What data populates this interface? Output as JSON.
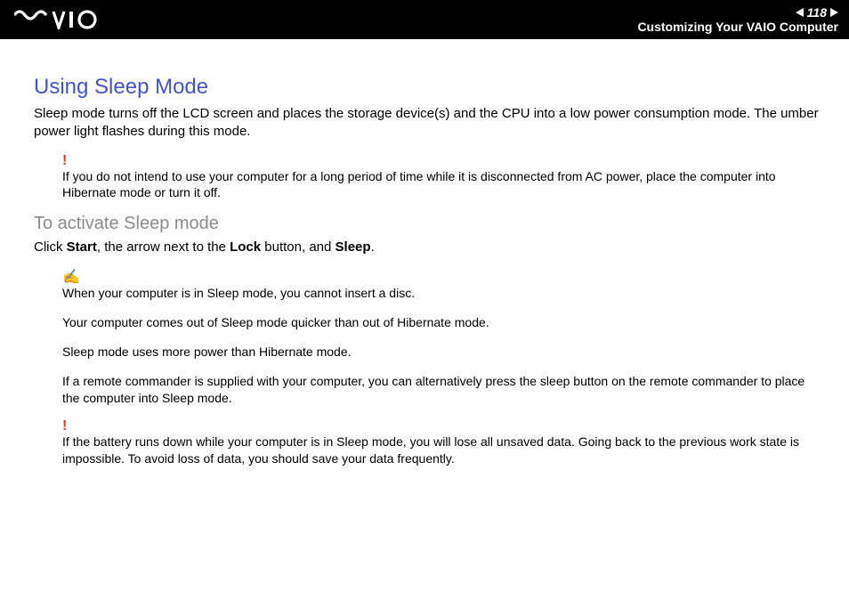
{
  "header": {
    "page_number": "118",
    "section": "Customizing Your VAIO Computer"
  },
  "main": {
    "title": "Using Sleep Mode",
    "intro": "Sleep mode turns off the LCD screen and places the storage device(s) and the CPU into a low power consumption mode. The umber power light flashes during this mode.",
    "warning1": "If you do not intend to use your computer for a long period of time while it is disconnected from AC power, place the computer into Hibernate mode or turn it off.",
    "subheading": "To activate Sleep mode",
    "instruction_prefix": "Click ",
    "bold_start": "Start",
    "instruction_mid1": ", the arrow next to the ",
    "bold_lock": "Lock",
    "instruction_mid2": " button, and ",
    "bold_sleep": "Sleep",
    "instruction_suffix": ".",
    "note1": "When your computer is in Sleep mode, you cannot insert a disc.",
    "note2": "Your computer comes out of Sleep mode quicker than out of Hibernate mode.",
    "note3": "Sleep mode uses more power than Hibernate mode.",
    "note4": "If a remote commander is supplied with your computer, you can alternatively press the sleep button on the remote commander to place the computer into Sleep mode.",
    "warning2": "If the battery runs down while your computer is in Sleep mode, you will lose all unsaved data. Going back to the previous work state is impossible. To avoid loss of data, you should save your data frequently."
  }
}
